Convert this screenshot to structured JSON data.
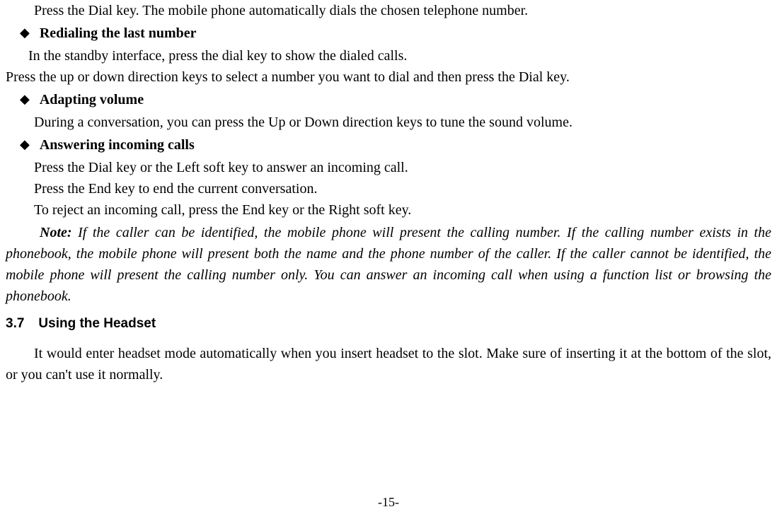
{
  "p1": "Press the Dial key. The mobile phone automatically dials the chosen telephone number.",
  "b1": "Redialing the last number",
  "p2": "In the standby interface, press the dial key to show the dialed calls.",
  "p3": "Press the up or down direction keys to select a number you want to dial and then press the Dial key.",
  "b2": "Adapting volume",
  "p4": "During a conversation, you can press the Up or Down direction keys to tune the sound volume.",
  "b3": "Answering incoming calls",
  "p5": "Press the Dial key or the Left soft key to answer an incoming call.",
  "p6": "Press the End key to end the current conversation.",
  "p7": "To reject an incoming call, press the End key or the Right soft key.",
  "note_label": "Note:",
  "note_text": " If the caller can be identified, the mobile phone will present the calling number. If the calling number exists in the phonebook, the mobile phone will present both the name and the phone number of the caller. If the caller cannot be identified, the mobile phone will present the calling number only. You can answer an incoming call when using a function list or browsing the phonebook.",
  "section_num": "3.7",
  "section_title": "Using the Headset",
  "p8": "It would enter headset mode automatically when you insert headset to the slot. Make sure of inserting it at the bottom of the slot, or you can't use it normally.",
  "page_num": "-15-"
}
